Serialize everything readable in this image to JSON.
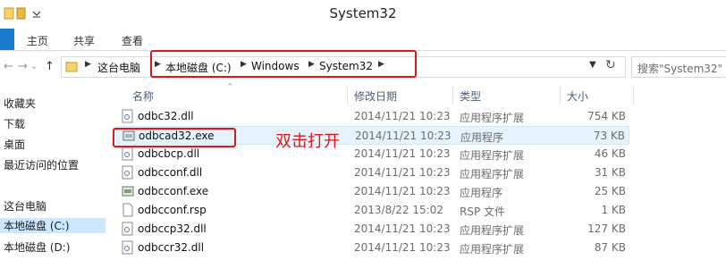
{
  "window": {
    "title": "System32"
  },
  "ribbon": {
    "tabs": [
      "主页",
      "共享",
      "查看"
    ]
  },
  "nav": {
    "back": "←",
    "forward": "→",
    "up": "↑",
    "recent": "⌄",
    "breadcrumbs": [
      "这台电脑",
      "本地磁盘 (C:)",
      "Windows",
      "System32"
    ],
    "refresh": "↻",
    "search_placeholder": "搜索\"System32\""
  },
  "sidebar": {
    "items": [
      "收藏夹",
      "下载",
      "桌面",
      "最近访问的位置",
      "这台电脑",
      "本地磁盘 (C:)",
      "本地磁盘 (D:)"
    ]
  },
  "columns": {
    "name": "名称",
    "date": "修改日期",
    "type": "类型",
    "size": "大小"
  },
  "files": [
    {
      "name": "odbc32.dll",
      "date": "2014/11/21 10:23",
      "type": "应用程序扩展",
      "size": "754 KB",
      "icon": "dll-icon"
    },
    {
      "name": "odbcad32.exe",
      "date": "2014/11/21 10:23",
      "type": "应用程序",
      "size": "73 KB",
      "icon": "exe-icon"
    },
    {
      "name": "odbcbcp.dll",
      "date": "2014/11/21 10:23",
      "type": "应用程序扩展",
      "size": "46 KB",
      "icon": "dll-icon"
    },
    {
      "name": "odbcconf.dll",
      "date": "2014/11/21 10:23",
      "type": "应用程序扩展",
      "size": "31 KB",
      "icon": "dll-icon"
    },
    {
      "name": "odbcconf.exe",
      "date": "2014/11/21 10:23",
      "type": "应用程序",
      "size": "25 KB",
      "icon": "exe-icon"
    },
    {
      "name": "odbcconf.rsp",
      "date": "2013/8/22 15:02",
      "type": "RSP 文件",
      "size": "1 KB",
      "icon": "file-icon"
    },
    {
      "name": "odbccp32.dll",
      "date": "2014/11/21 10:23",
      "type": "应用程序扩展",
      "size": "127 KB",
      "icon": "dll-icon"
    },
    {
      "name": "odbccr32.dll",
      "date": "2014/11/21 10:23",
      "type": "应用程序扩展",
      "size": "87 KB",
      "icon": "dll-icon"
    }
  ],
  "annotation": {
    "text": "双击打开",
    "color": "#e0151b"
  },
  "colors": {
    "accent": "#1979ca",
    "highlight": "#e0151b",
    "selected_row": "#e5f3ff"
  }
}
